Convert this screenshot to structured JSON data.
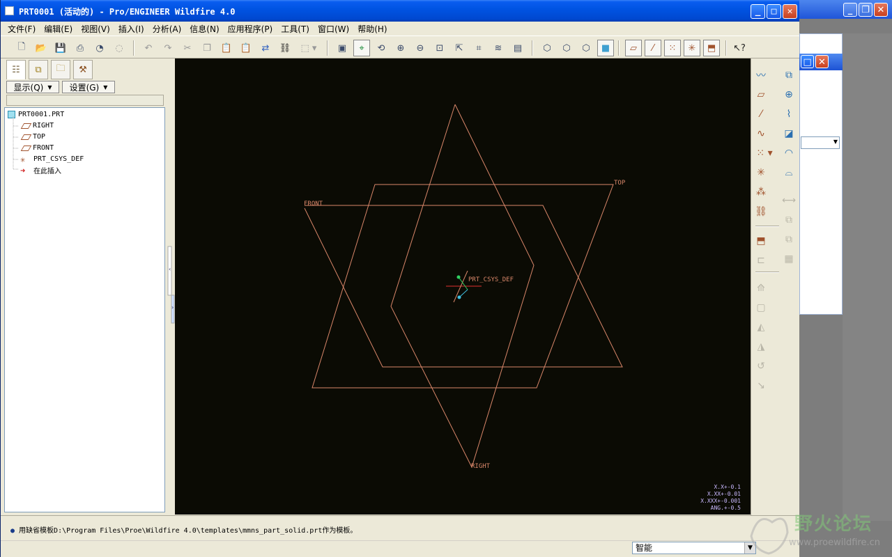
{
  "window": {
    "title": "PRT0001 (活动的) - Pro/ENGINEER Wildfire 4.0",
    "minimize": "_",
    "maximize": "□",
    "close": "✕"
  },
  "menu": [
    "文件(F)",
    "编辑(E)",
    "视图(V)",
    "插入(I)",
    "分析(A)",
    "信息(N)",
    "应用程序(P)",
    "工具(T)",
    "窗口(W)",
    "帮助(H)"
  ],
  "toolbar_icons": [
    "new-icon",
    "open-icon",
    "save-icon",
    "print-icon",
    "send-icon",
    "email-icon",
    "undo-icon",
    "redo-icon",
    "cut-icon",
    "copy-icon",
    "paste-icon",
    "paste-special-icon",
    "regenerate-icon",
    "find-icon",
    "select-box-icon",
    "repaint-icon",
    "spin-center-icon",
    "orient-icon",
    "zoom-in-icon",
    "zoom-out-icon",
    "refit-icon",
    "reorient-icon",
    "saved-views-icon",
    "layers-icon",
    "view-manager-icon",
    "wireframe-icon",
    "hidden-line-icon",
    "no-hidden-icon",
    "shading-icon",
    "datum-planes-icon",
    "datum-axes-icon",
    "datum-points-icon",
    "csys-icon",
    "annotations-icon",
    "context-help-icon"
  ],
  "left_panel": {
    "tabs": [
      "model-tree-icon",
      "layer-tree-icon",
      "folder-browser-icon",
      "favorites-icon"
    ],
    "show_button": "显示(Q)",
    "settings_button": "设置(G)",
    "tree": {
      "root": "PRT0001.PRT",
      "items": [
        "RIGHT",
        "TOP",
        "FRONT",
        "PRT_CSYS_DEF",
        "在此插入"
      ]
    }
  },
  "graphics": {
    "labels": {
      "front": "FRONT",
      "top": "TOP",
      "right": "RIGHT",
      "csys": "PRT_CSYS_DEF"
    },
    "tolerances": [
      "X.X+-0.1",
      "X.XX+-0.01",
      "X.XXX+-0.001",
      "ANG.+-0.5"
    ],
    "colors": {
      "background": "#0b0b04",
      "datum": "#d9876a",
      "csys_red": "#e03030",
      "csys_green": "#30d060",
      "csys_cyan": "#40c0e0"
    }
  },
  "status": {
    "message": "用缺省模板D:\\Program Files\\Proe\\Wildfire 4.0\\templates\\mmns_part_solid.prt作为模板。",
    "filter": "智能"
  },
  "watermark": {
    "title": "野火论坛",
    "url": "www.proewildfire.cn"
  }
}
